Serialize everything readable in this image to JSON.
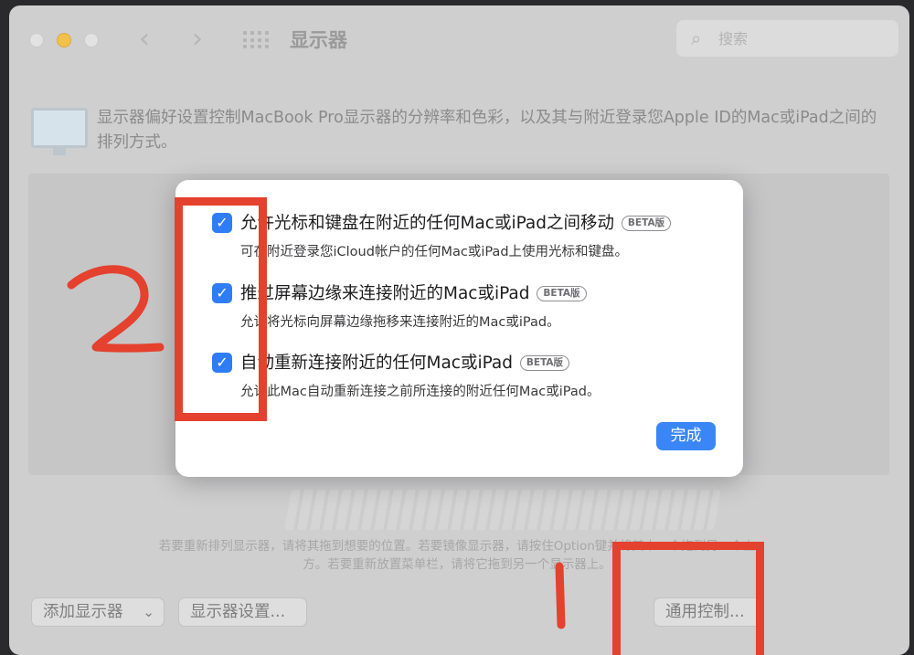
{
  "window": {
    "title": "显示器",
    "search_placeholder": "搜索"
  },
  "description": "显示器偏好设置控制MacBook Pro显示器的分辨率和色彩，以及其与附近登录您Apple ID的Mac或iPad之间的排列方式。",
  "hint": {
    "line1": "若要重新排列显示器，请将其拖到想要的位置。若要镜像显示器，请按住Option键并将其中一个拖到另一个上",
    "line2": "方。若要重新放置菜单栏，请将它拖到另一个显示器上。"
  },
  "buttons": {
    "add_display": "添加显示器",
    "display_settings": "显示器设置...",
    "universal_control": "通用控制..."
  },
  "dialog": {
    "options": [
      {
        "checked": true,
        "title": "允许光标和键盘在附近的任何Mac或iPad之间移动",
        "badge": "BETA版",
        "subtitle": "可在附近登录您iCloud帐户的任何Mac或iPad上使用光标和键盘。"
      },
      {
        "checked": true,
        "title": "推过屏幕边缘来连接附近的Mac或iPad",
        "badge": "BETA版",
        "subtitle": "允许将光标向屏幕边缘拖移来连接附近的Mac或iPad。"
      },
      {
        "checked": true,
        "title": "自动重新连接附近的任何Mac或iPad",
        "badge": "BETA版",
        "subtitle": "允许此Mac自动重新连接之前所连接的附近任何Mac或iPad。"
      }
    ],
    "done_label": "完成",
    "checkmark": "✓"
  },
  "annotations": {
    "accent_color": "#e4412e",
    "marks": [
      "2",
      "1"
    ]
  },
  "icons": {
    "back": "‹",
    "forward": "›",
    "search": "⌕",
    "chevron": "⌄"
  }
}
